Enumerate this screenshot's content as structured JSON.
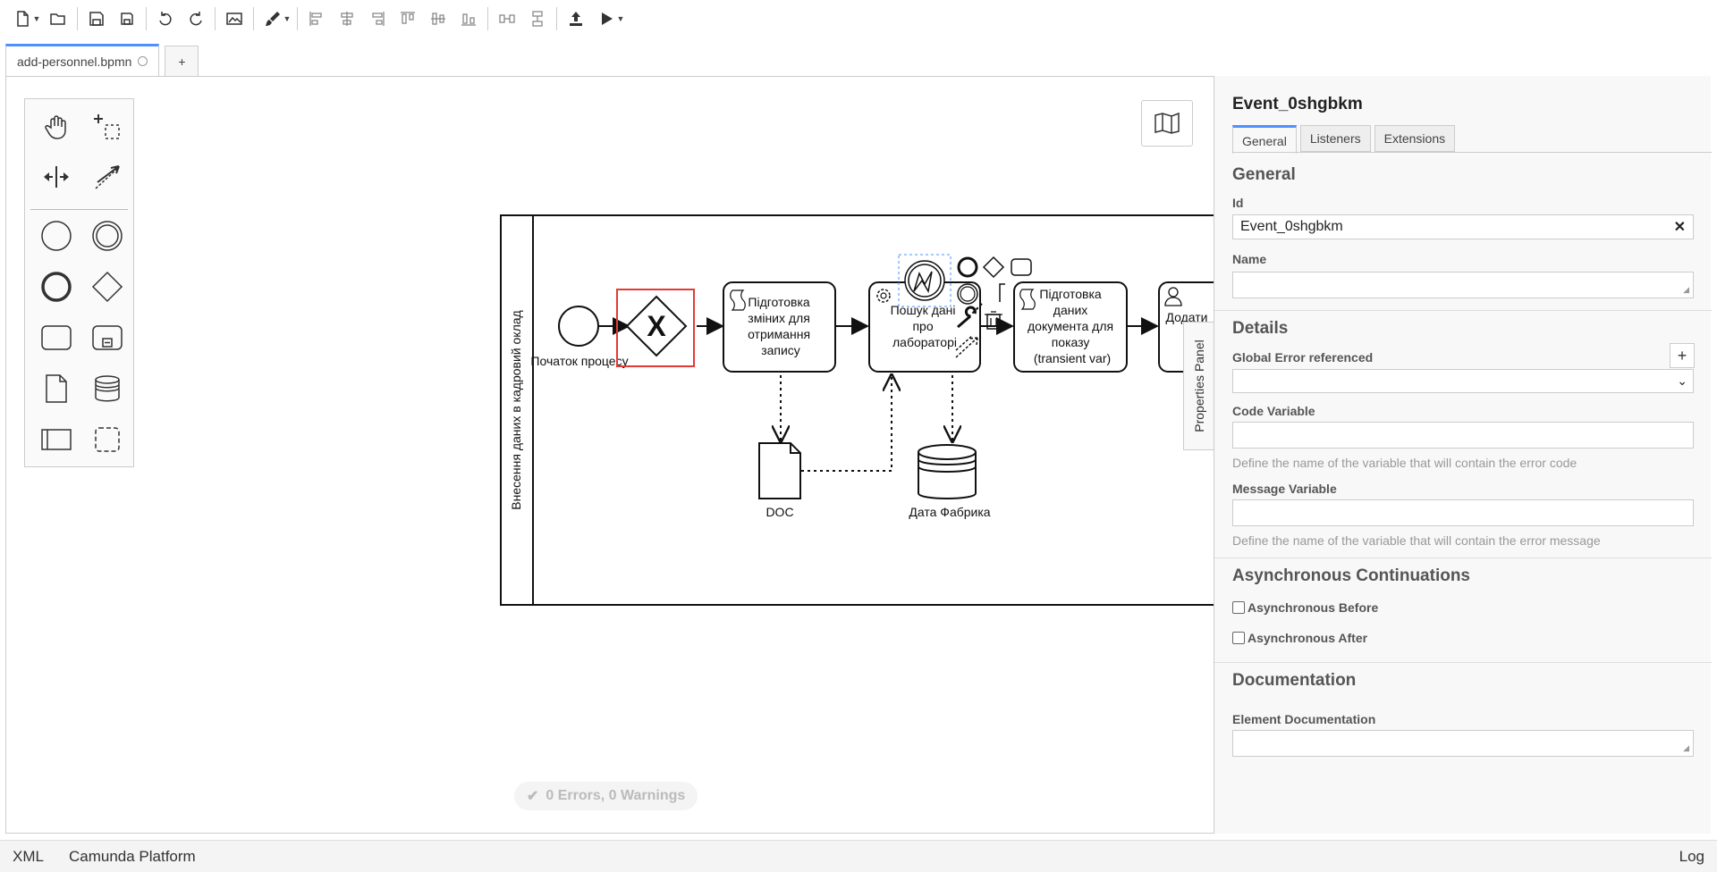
{
  "toolbar": {
    "items": [
      "new-file",
      "open-file",
      "save",
      "save-as",
      "undo",
      "redo",
      "export-image",
      "color-picker",
      "align-left",
      "align-center",
      "align-right",
      "align-top",
      "align-middle",
      "align-bottom",
      "distribute-horizontal",
      "distribute-vertical",
      "deploy",
      "start-instance"
    ]
  },
  "tabs": {
    "file_name": "add-personnel.bpmn",
    "add_label": "+"
  },
  "diagram": {
    "lane_label": "Внесення даних в кадровий оклад",
    "start_event_label": "Початок процесу",
    "task1": [
      "Підготовка",
      "зміних для",
      "отримання",
      "запису"
    ],
    "task2": [
      "Пошук дані",
      "про",
      "лабораторі"
    ],
    "task3": [
      "Підготовка",
      "даних",
      "документа для",
      "показу",
      "(transient var)"
    ],
    "task4": [
      "Додати"
    ],
    "doc_label": "DOC",
    "datastore_label": "Дата Фабрика"
  },
  "lint": {
    "text": "0 Errors, 0 Warnings"
  },
  "props": {
    "toggle_label": "Properties Panel",
    "title": "Event_0shgbkm",
    "tabs": [
      "General",
      "Listeners",
      "Extensions"
    ],
    "general_heading": "General",
    "id_label": "Id",
    "id_value": "Event_0shgbkm",
    "name_label": "Name",
    "name_value": "",
    "details_heading": "Details",
    "global_error_label": "Global Error referenced",
    "code_variable_label": "Code Variable",
    "code_variable_hint": "Define the name of the variable that will contain the error code",
    "message_variable_label": "Message Variable",
    "message_variable_hint": "Define the name of the variable that will contain the error message",
    "async_heading": "Asynchronous Continuations",
    "async_before": "Asynchronous Before",
    "async_after": "Asynchronous After",
    "documentation_heading": "Documentation",
    "element_documentation_label": "Element Documentation"
  },
  "status_bar": {
    "xml": "XML",
    "platform": "Camunda Platform",
    "log": "Log"
  },
  "colors": {
    "accent": "#4d90fe",
    "selection": "#e53935"
  }
}
